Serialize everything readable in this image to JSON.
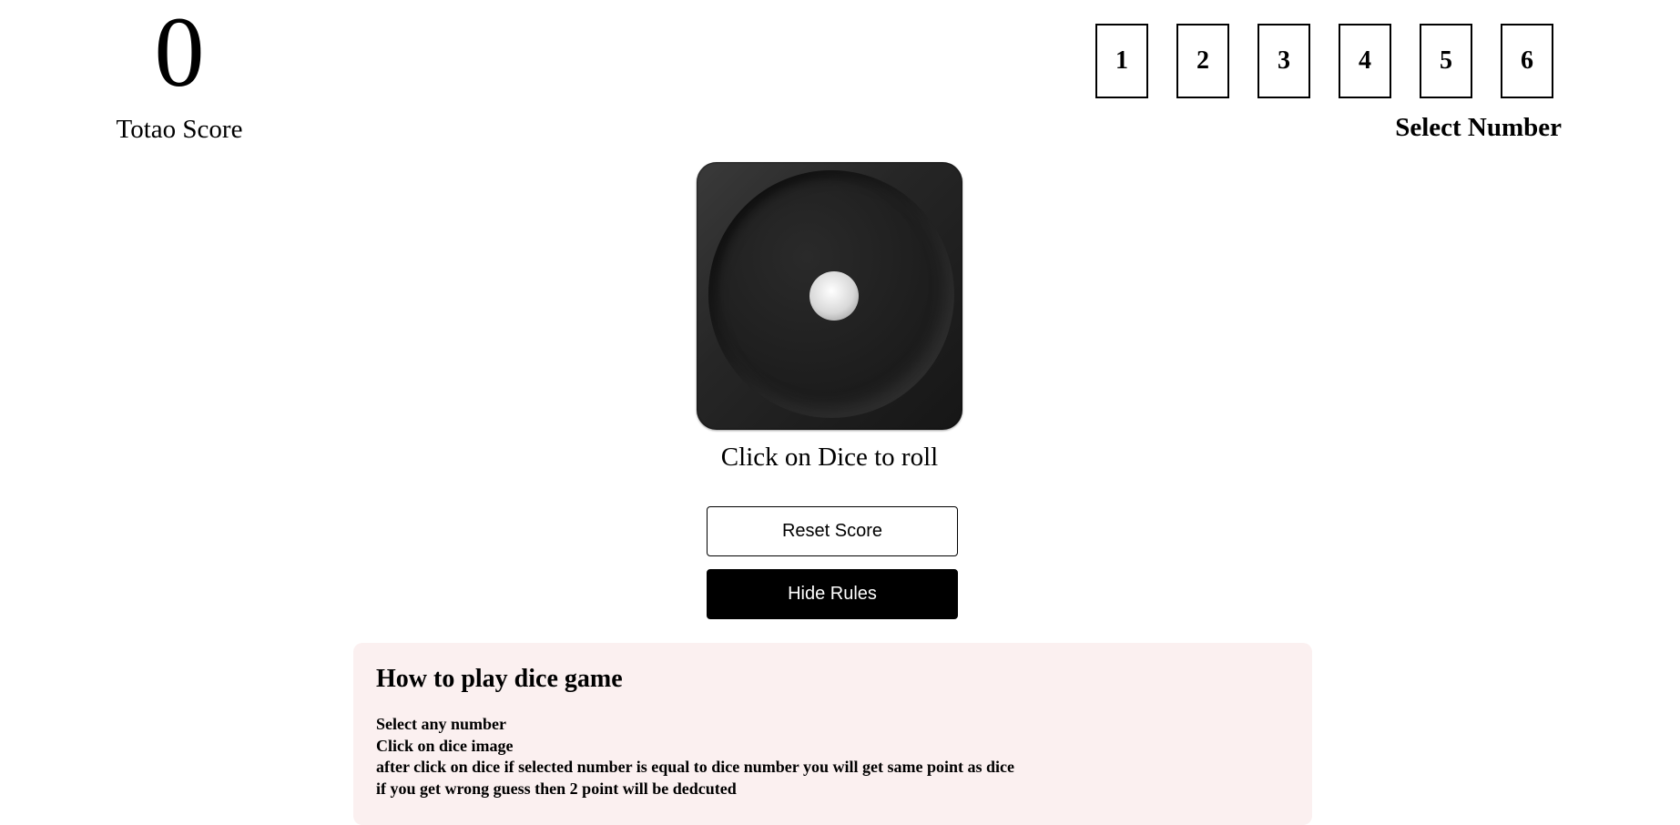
{
  "score": {
    "value": "0",
    "label": "Totao Score"
  },
  "number_selector": {
    "numbers": [
      "1",
      "2",
      "3",
      "4",
      "5",
      "6"
    ],
    "label": "Select Number"
  },
  "dice": {
    "current_face": 1,
    "caption": "Click on Dice to roll"
  },
  "buttons": {
    "reset_label": "Reset Score",
    "hide_rules_label": "Hide Rules"
  },
  "rules": {
    "title": "How to play dice game",
    "lines": [
      "Select any number",
      "Click on dice image",
      "after click on dice if selected number is equal to dice number you will get same point as dice",
      "if you get wrong guess then 2 point will be dedcuted"
    ]
  },
  "colors": {
    "background": "#ffffff",
    "rules_panel_bg": "#fbf0f0",
    "primary_button_bg": "#000000",
    "dice_body": "#262626"
  }
}
